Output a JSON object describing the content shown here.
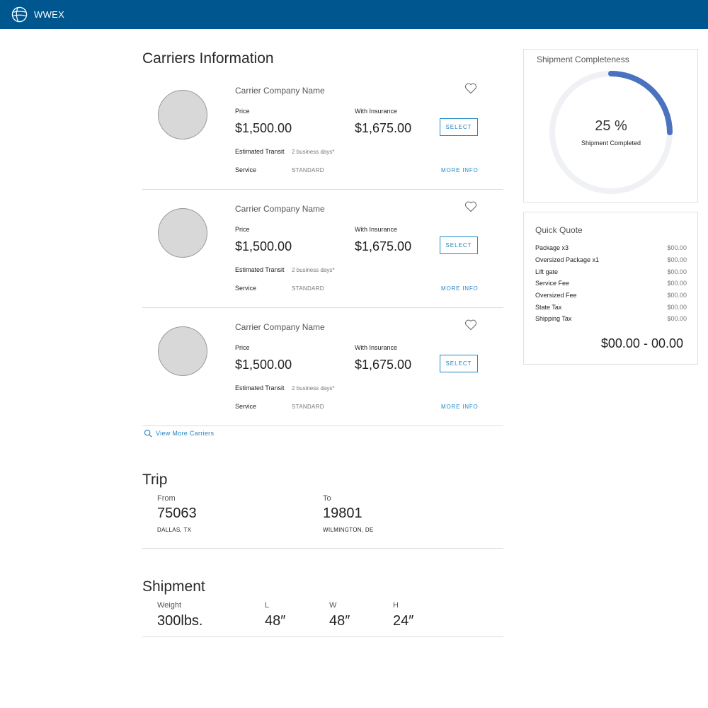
{
  "header": {
    "brand": "WWEX",
    "logo_icon": "globe-icon",
    "bg_color": "#00568e"
  },
  "carriers": {
    "title": "Carriers Information",
    "items": [
      {
        "company": "Carrier Company Name",
        "price_label": "Price",
        "price": "$1,500.00",
        "insurance_label": "With Insurance",
        "insurance_price": "$1,675.00",
        "select_label": "SELECT",
        "transit_label": "Estimated Transit",
        "transit_value": "2 business days*",
        "service_label": "Service",
        "service_value": "STANDARD",
        "more_info_label": "MORE INFO"
      },
      {
        "company": "Carrier Company Name",
        "price_label": "Price",
        "price": "$1,500.00",
        "insurance_label": "With Insurance",
        "insurance_price": "$1,675.00",
        "select_label": "SELECT",
        "transit_label": "Estimated Transit",
        "transit_value": "2 business days*",
        "service_label": "Service",
        "service_value": "STANDARD",
        "more_info_label": "MORE INFO"
      },
      {
        "company": "Carrier Company Name",
        "price_label": "Price",
        "price": "$1,500.00",
        "insurance_label": "With Insurance",
        "insurance_price": "$1,675.00",
        "select_label": "SELECT",
        "transit_label": "Estimated Transit",
        "transit_value": "2 business days*",
        "service_label": "Service",
        "service_value": "STANDARD",
        "more_info_label": "MORE INFO"
      }
    ],
    "view_more_label": "View More Carriers"
  },
  "trip": {
    "title": "Trip",
    "from_label": "From",
    "from_zip": "75063",
    "from_city": "DALLAS, TX",
    "to_label": "To",
    "to_zip": "19801",
    "to_city": "WILMINGTON, DE"
  },
  "shipment": {
    "title": "Shipment",
    "weight_label": "Weight",
    "weight": "300lbs.",
    "l_label": "L",
    "l": "48″",
    "w_label": "W",
    "w": "48″",
    "h_label": "H",
    "h": "24″"
  },
  "completeness": {
    "title": "Shipment Completeness",
    "percent": 25,
    "percent_text": "25 %",
    "label": "Shipment Completed",
    "accent_color": "#4a72be",
    "track_color": "#eff1f4"
  },
  "quote": {
    "title": "Quick Quote",
    "rows": [
      {
        "name": "Package x3",
        "amount": "$00.00"
      },
      {
        "name": "Oversized Package x1",
        "amount": "$00.00"
      },
      {
        "name": "Lift gate",
        "amount": "$00.00"
      },
      {
        "name": "Service Fee",
        "amount": "$00.00"
      },
      {
        "name": "Oversized Fee",
        "amount": "$00.00"
      },
      {
        "name": "State Tax",
        "amount": "$00.00"
      },
      {
        "name": "Shipping Tax",
        "amount": "$00.00"
      }
    ],
    "total": "$00.00 - 00.00"
  }
}
